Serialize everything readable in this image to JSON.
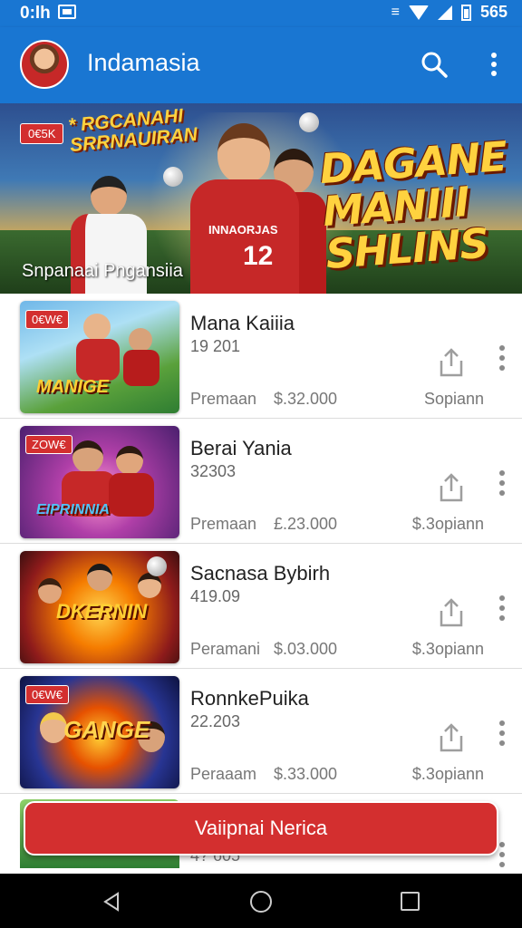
{
  "status_bar": {
    "time": "0:lh",
    "right_text": "565"
  },
  "app_bar": {
    "title": "Indamasia"
  },
  "hero": {
    "badge": "0€5K",
    "top_text_line1": "RGCANAHI",
    "top_text_line2": "SRRNAUIRAN",
    "jersey_text": "INNAORJAS",
    "jersey_number": "12",
    "title_line1": "DAGANE",
    "title_line2": "MANIII",
    "title_line3": "SHLINS",
    "caption": "Snpanaai Pngansiia"
  },
  "items": [
    {
      "tag": "0€W€",
      "art_text": "MANIGE",
      "title": "Mana Kaiiia",
      "subtitle": "19 201",
      "meta": "Premaan",
      "price": "$.32.000",
      "action": "Sopiann"
    },
    {
      "tag": "ZOW€",
      "art_text": "EIPRINNIA",
      "title": "Berai Yania",
      "subtitle": "32303",
      "meta": "Premaan",
      "price": "£.23.000",
      "action": "$.3opiann"
    },
    {
      "tag": "",
      "art_text": "DKERNIN",
      "title": "Sacnasa Bybirh",
      "subtitle": "419.09",
      "meta": "Peramani",
      "price": "$.03.000",
      "action": "$.3opiann"
    },
    {
      "tag": "0€W€",
      "art_text": "GANGE",
      "title": "RonnkePuika",
      "subtitle": "22.203",
      "meta": "Peraaam",
      "price": "$.33.000",
      "action": "$.3opiann"
    }
  ],
  "partial_item": {
    "subtitle": "4? 605"
  },
  "cta": {
    "label": "Vaiipnai Nerica"
  },
  "colors": {
    "primary": "#1976d2",
    "accent": "#d32f2f"
  }
}
